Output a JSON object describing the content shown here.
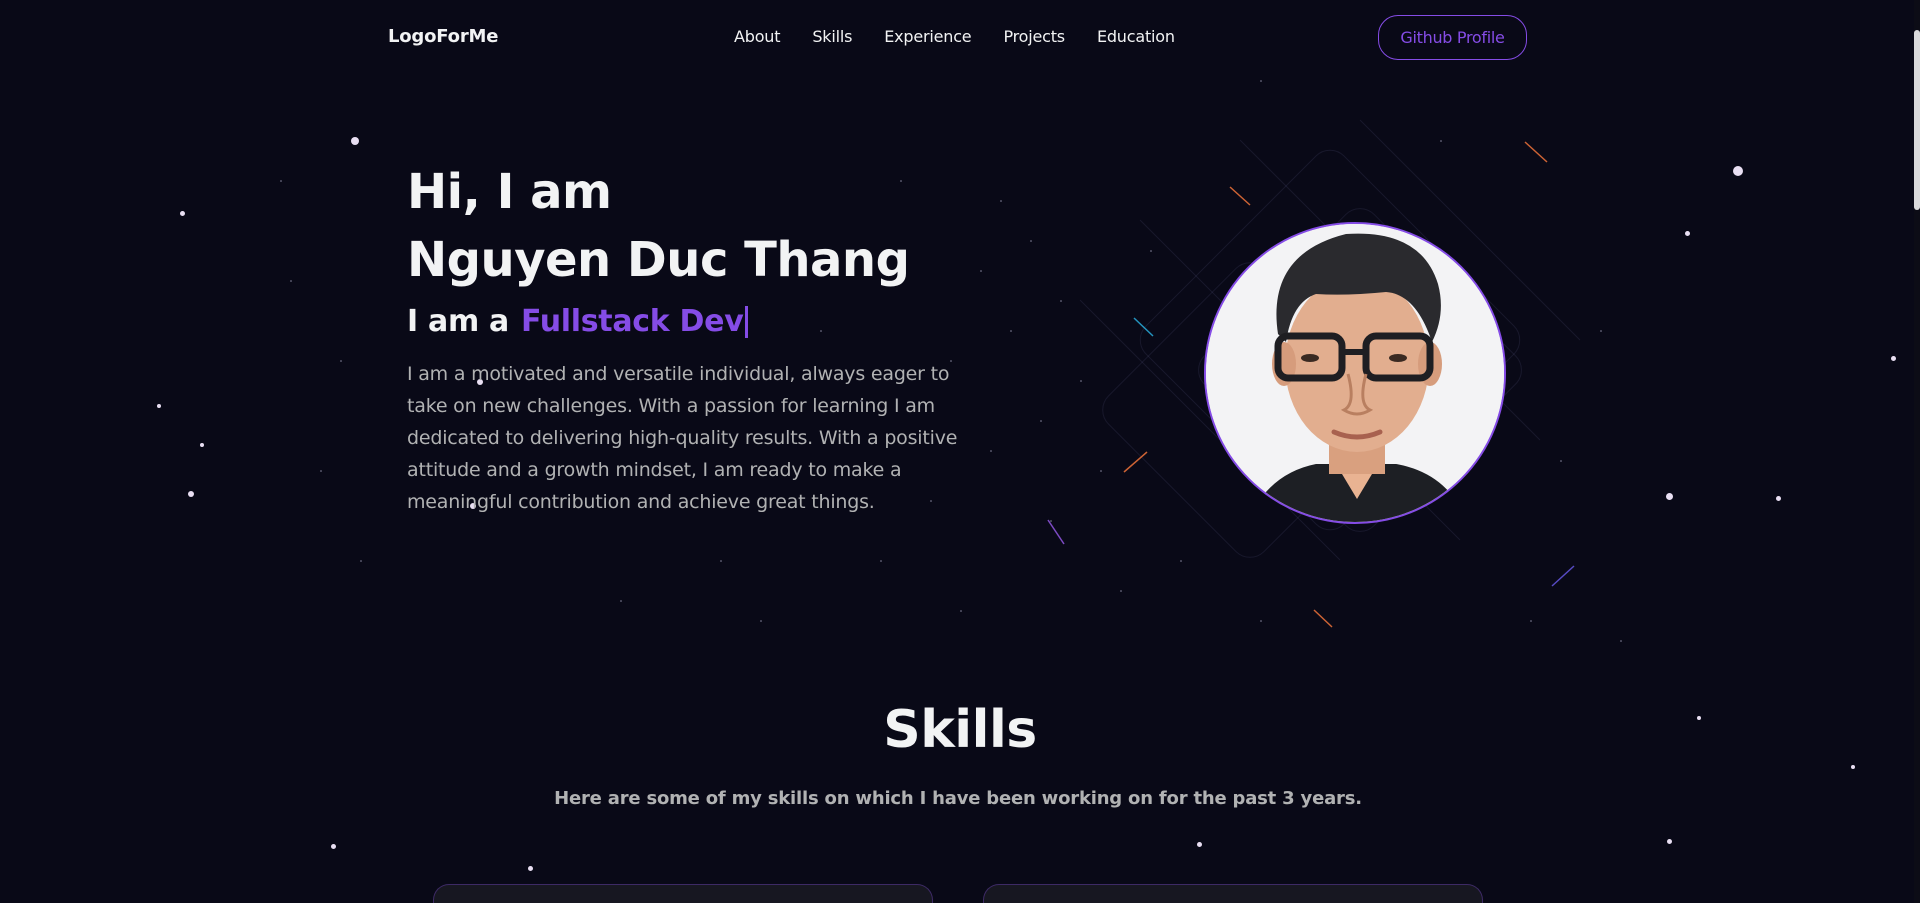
{
  "nav": {
    "logo": "LogoForMe",
    "links": [
      {
        "label": "About"
      },
      {
        "label": "Skills"
      },
      {
        "label": "Experience"
      },
      {
        "label": "Projects"
      },
      {
        "label": "Education"
      }
    ],
    "github_button": "Github Profile"
  },
  "hero": {
    "greeting": "Hi, I am",
    "name": "Nguyen Duc Thang",
    "role_prefix": "I am a",
    "role": "Fullstack Dev",
    "description": "I am a motivated and versatile individual, always eager to take on new challenges. With a passion for learning I am dedicated to delivering high-quality results. With a positive attitude and a growth mindset, I am ready to make a meaningful contribution and achieve great things."
  },
  "skills": {
    "title": "Skills",
    "subtitle": "Here are some of my skills on which I have been working on for the past 3 years."
  },
  "colors": {
    "background": "#090917",
    "accent": "#854ce6",
    "text_primary": "#f2f3f4",
    "text_secondary": "#b1b2b3"
  },
  "icons": {
    "avatar": "profile-photo"
  }
}
